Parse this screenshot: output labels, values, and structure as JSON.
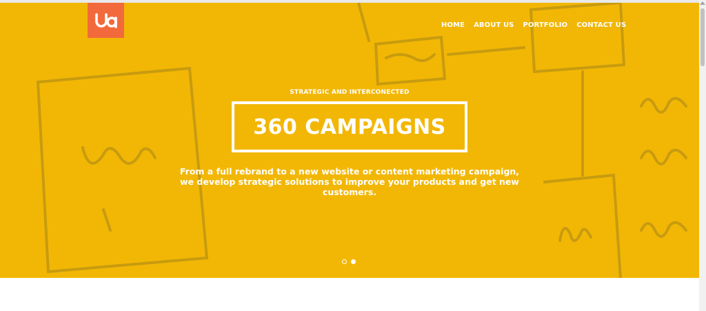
{
  "brand": {
    "logo_text": "ua",
    "accent": "#f26a3b",
    "hero_color": "#f2b705"
  },
  "nav": {
    "items": [
      {
        "label": "HOME"
      },
      {
        "label": "ABOUT US"
      },
      {
        "label": "PORTFOLIO"
      },
      {
        "label": "CONTACT US"
      }
    ]
  },
  "hero": {
    "eyebrow": "STRATEGIC AND INTERCONECTED",
    "title": "360 CAMPAIGNS",
    "lede": "From a full rebrand to a new website or content marketing campaign, we develop strategic solutions to improve your products and get new customers.",
    "slides": {
      "count": 2,
      "active_index": 1
    }
  },
  "icons": {
    "logo": "ua-logo-icon",
    "scroll_up": "arrow-up-icon"
  }
}
